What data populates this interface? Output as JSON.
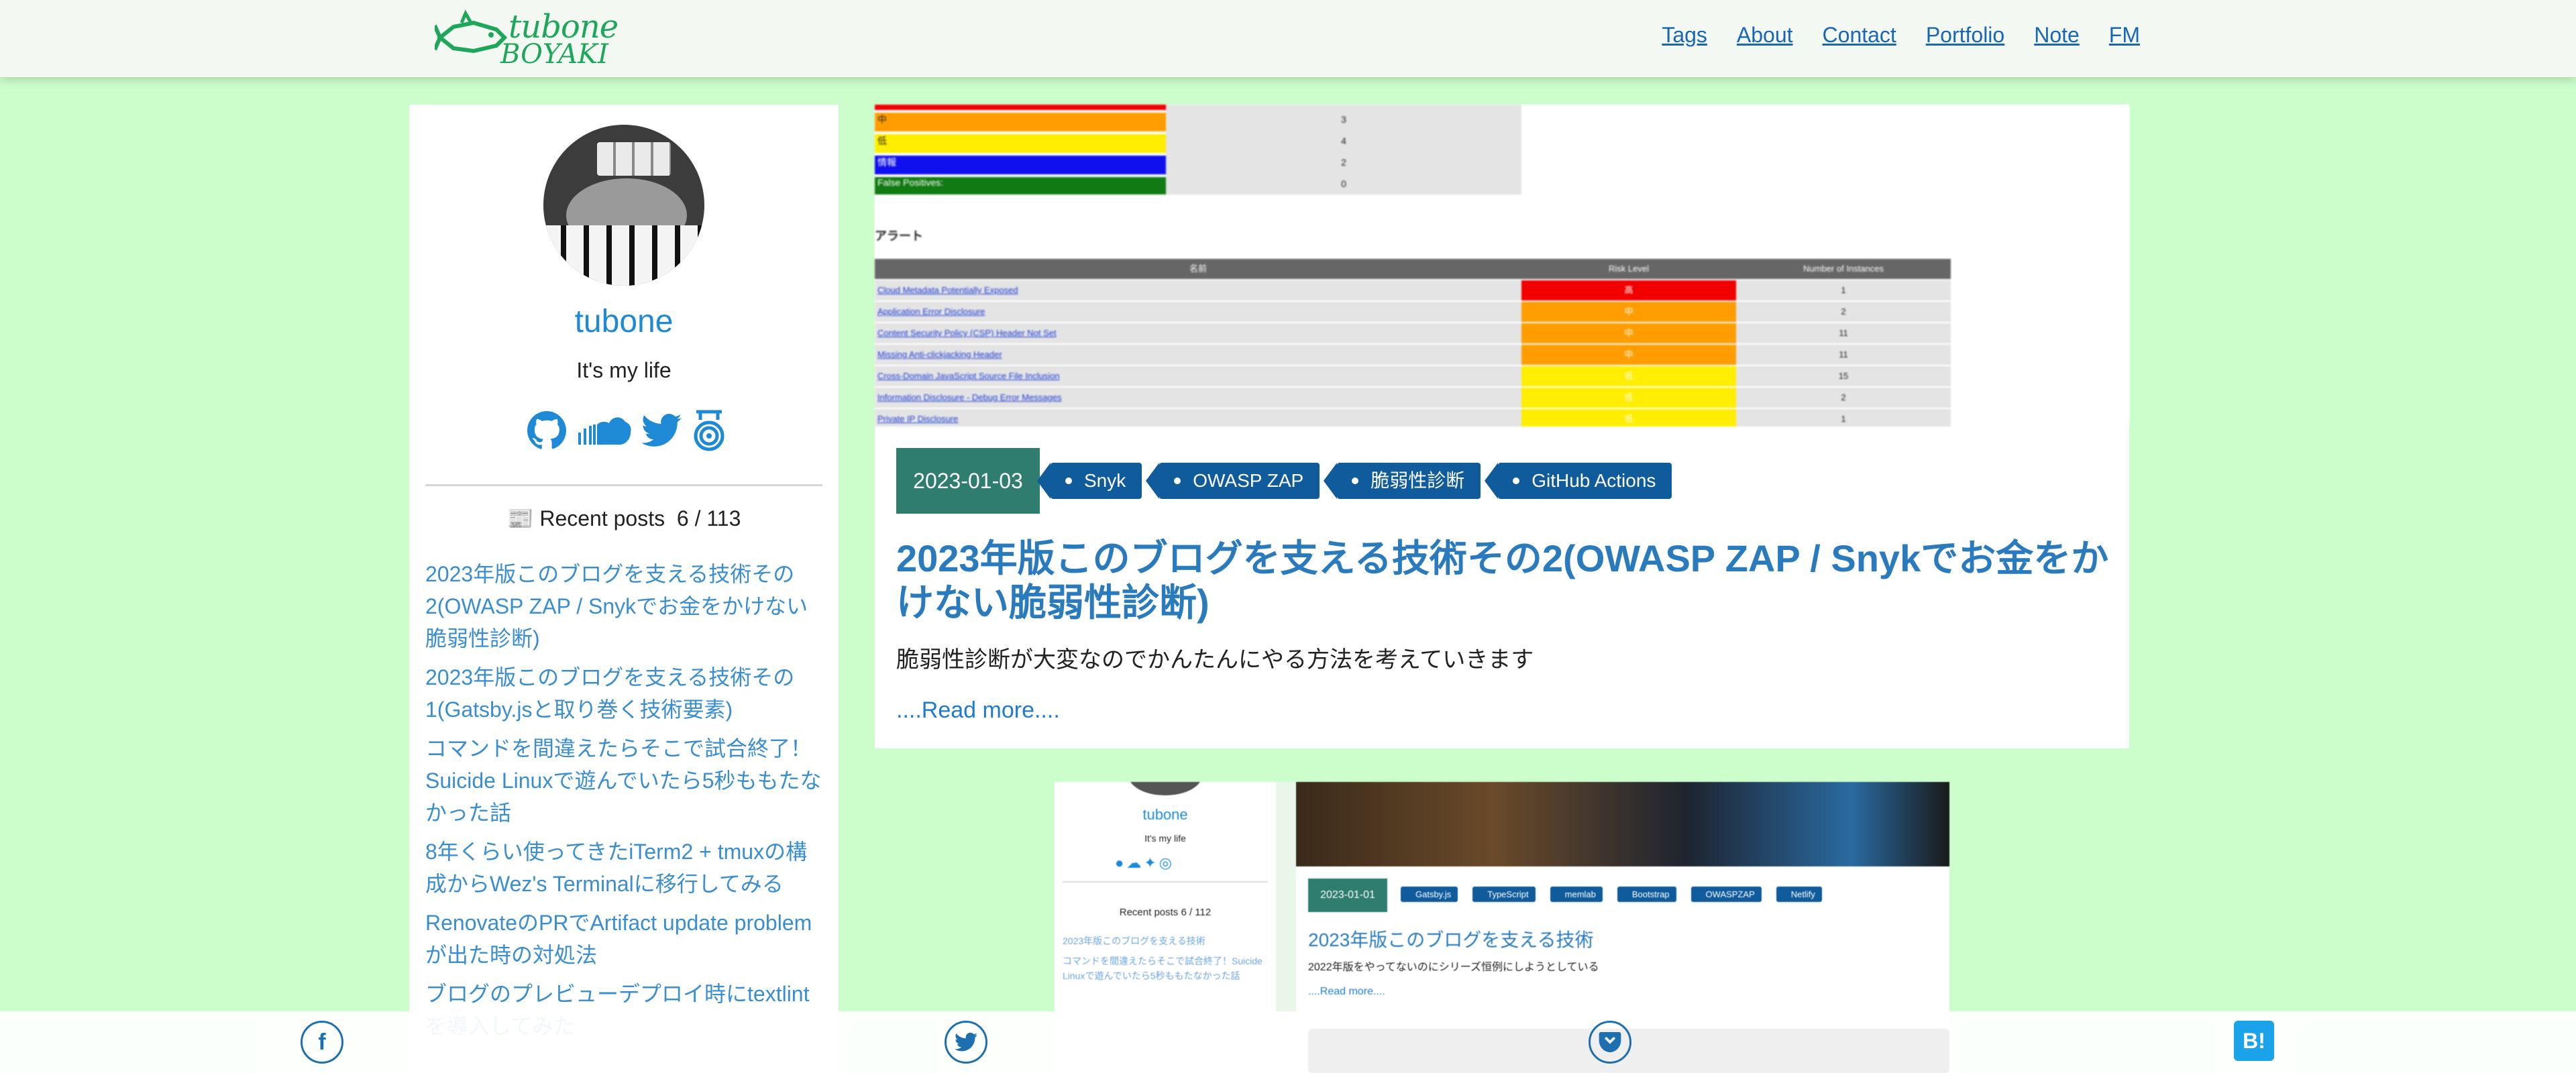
{
  "header": {
    "logo_top": "tubone",
    "logo_bottom": "BOYAKI",
    "nav": [
      {
        "label": "Tags"
      },
      {
        "label": "About"
      },
      {
        "label": "Contact"
      },
      {
        "label": "Portfolio"
      },
      {
        "label": "Note"
      },
      {
        "label": "FM"
      }
    ]
  },
  "sidebar": {
    "name": "tubone",
    "tagline": "It's my life",
    "social_icons": [
      "github-icon",
      "soundcloud-icon",
      "twitter-icon",
      "scrapbox-icon"
    ],
    "recent_label": "Recent posts",
    "recent_count": "6 / 113",
    "recent_posts": [
      "2023年版このブログを支える技術その2(OWASP ZAP / Snykでお金をかけない脆弱性診断)",
      "2023年版このブログを支える技術その1(Gatsby.jsと取り巻く技術要素)",
      "コマンドを間違えたらそこで試合終了！Suicide Linuxで遊んでいたら5秒ももたなかった話",
      "8年くらい使ってきたiTerm2 + tmuxの構成からWez's Terminalに移行してみる",
      "RenovateのPRでArtifact update problemが出た時の対処法",
      "ブログのプレビューデプロイ時にtextlintを導入してみた"
    ]
  },
  "post": {
    "date": "2023-01-03",
    "tags": [
      "Snyk",
      "OWASP ZAP",
      "脆弱性診断",
      "GitHub Actions"
    ],
    "title": "2023年版このブログを支える技術その2(OWASP ZAP / Snykでお金をかけない脆弱性診断)",
    "description": "脆弱性診断が大変なのでかんたんにやる方法を考えていきます",
    "read_more": "....Read more....",
    "screenshot": {
      "summary_counts": [
        "3",
        "4",
        "2",
        "0"
      ],
      "summary_labels": [
        "中",
        "低",
        "情報",
        "False Positives:"
      ],
      "alerts_heading": "アラート",
      "alert_columns": [
        "名前",
        "Risk Level",
        "Number of Instances"
      ],
      "alerts": [
        {
          "name": "Cloud Metadata Potentially Exposed",
          "risk": "高",
          "count": "1",
          "color": "#f20000"
        },
        {
          "name": "Application Error Disclosure",
          "risk": "中",
          "count": "2",
          "color": "#ff9d00"
        },
        {
          "name": "Content Security Policy (CSP) Header Not Set",
          "risk": "中",
          "count": "11",
          "color": "#ff9d00"
        },
        {
          "name": "Missing Anti-clickjacking Header",
          "risk": "中",
          "count": "11",
          "color": "#ff9d00"
        },
        {
          "name": "Cross-Domain JavaScript Source File Inclusion",
          "risk": "低",
          "count": "15",
          "color": "#ffee00"
        },
        {
          "name": "Information Disclosure - Debug Error Messages",
          "risk": "低",
          "count": "2",
          "color": "#ffee00"
        },
        {
          "name": "Private IP Disclosure",
          "risk": "低",
          "count": "1",
          "color": "#ffee00"
        }
      ]
    }
  },
  "preview": {
    "name": "tubone",
    "tagline": "It's my life",
    "recent": "Recent posts  6 / 112",
    "date": "2023-01-01",
    "tags": [
      "Gatsby.js",
      "TypeScript",
      "memlab",
      "Bootstrap",
      "OWASPZAP",
      "Netlify"
    ],
    "title": "2023年版このブログを支える技術",
    "desc": "2022年版をやってないのにシリーズ恒例にしようとしている",
    "read_more": "....Read more....",
    "list": [
      "2023年版このブログを支える技術",
      "コマンドを間違えたらそこで試合終了！Suicide Linuxで遊んでいたら5秒ももたなかった話"
    ]
  },
  "share": {
    "facebook": "f",
    "twitter": "t",
    "pocket": "p",
    "hatena": "B!"
  },
  "colors": {
    "background": "#ccfecc",
    "link": "#1867b5",
    "date_badge": "#2e7d6f",
    "tag": "#0f5b9b"
  }
}
